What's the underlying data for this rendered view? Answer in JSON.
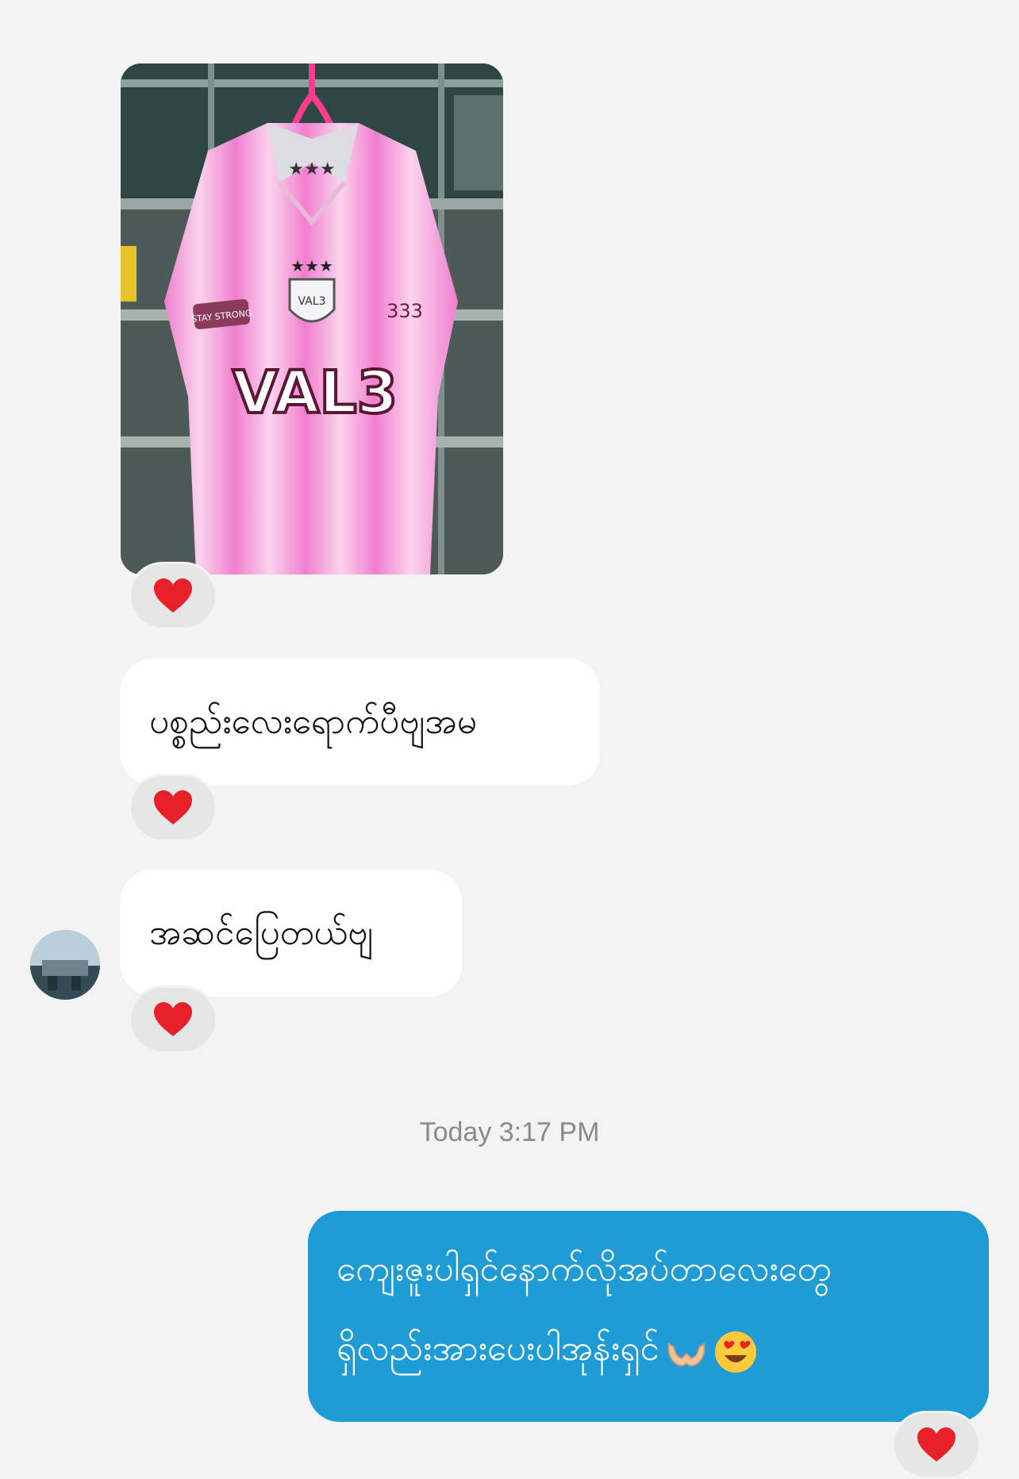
{
  "messages": {
    "incoming": [
      {
        "text": "ပစ္စည်းလေးရောက်ပီဗျအမ"
      },
      {
        "text": "အဆင်ပြေတယ်ဗျ"
      }
    ],
    "timestamp": "Today 3:17 PM",
    "outgoing": {
      "line1": "ကျေးဇူးပါရှင်နောက်လိုအပ်တာလေးတွေ",
      "line2": "ရှိလည်းအားပေးပါအုန်းရှင်"
    }
  },
  "photo": {
    "jersey_text": "VAL3",
    "badge_text": "VAL3",
    "patch_left": "STAY STRONG",
    "number": "333"
  },
  "colors": {
    "background": "#f3f3f3",
    "incoming_bubble": "#ffffff",
    "outgoing_bubble": "#1f9bd6",
    "reaction_pill": "#e6e6e6",
    "heart": "#e8202a"
  },
  "icons": [
    "heart-reaction-icon",
    "heart-hands-emoji",
    "heart-eyes-emoji",
    "avatar"
  ]
}
